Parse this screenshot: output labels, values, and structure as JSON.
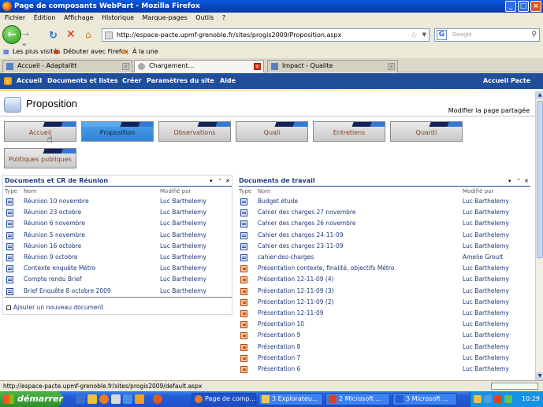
{
  "window": {
    "title": "Page de composants WebPart - Mozilla Firefox"
  },
  "menu": [
    "Fichier",
    "Édition",
    "Affichage",
    "Historique",
    "Marque-pages",
    "Outils",
    "?"
  ],
  "nav": {
    "url": "http://espace-pacte.upmf-grenoble.fr/sites/progis2009/Proposition.aspx",
    "search_placeholder": "Google"
  },
  "bookmarks": [
    "Les plus visités",
    "Débuter avec Firefox",
    "À la une"
  ],
  "tabs": [
    {
      "label": "Accueil - Adaptalitt",
      "active": false
    },
    {
      "label": "Chargement...",
      "active": true
    },
    {
      "label": "Impact - Qualite",
      "active": false
    }
  ],
  "sp_nav": {
    "items": [
      "Accueil",
      "Documents et listes",
      "Créer",
      "Paramètres du site",
      "Aide"
    ],
    "right": "Accueil Pacte"
  },
  "page": {
    "title": "Proposition",
    "modify_link": "Modifier la page partagée",
    "buttons": [
      {
        "label": "Accueil",
        "selected": false
      },
      {
        "label": "Proposition",
        "selected": true
      },
      {
        "label": "Observations",
        "selected": false
      },
      {
        "label": "Quali",
        "selected": false
      },
      {
        "label": "Entretiens",
        "selected": false
      },
      {
        "label": "Quanti",
        "selected": false
      },
      {
        "label": "Politiques publiques",
        "selected": false
      }
    ]
  },
  "left_part": {
    "title": "Documents et CR de Réunion",
    "headers": {
      "type": "Type",
      "name": "Nom",
      "modified_by": "Modifié par"
    },
    "rows": [
      {
        "icon": "word-doc-icon",
        "name": "Réunion 10 novembre",
        "by": "Luc Barthelemy"
      },
      {
        "icon": "word-doc-icon",
        "name": "Réunion 23 octobre",
        "by": "Luc Barthelemy"
      },
      {
        "icon": "word-doc-icon",
        "name": "Réunion 6 novembre",
        "by": "Luc Barthelemy"
      },
      {
        "icon": "word-doc-icon",
        "name": "Réunion 5 novembre",
        "by": "Luc Barthelemy"
      },
      {
        "icon": "word-doc-icon",
        "name": "Réunion 16 octobre",
        "by": "Luc Barthelemy"
      },
      {
        "icon": "word-doc-icon",
        "name": "Réunion 9 octobre",
        "by": "Luc Barthelemy"
      },
      {
        "icon": "word-doc-icon",
        "name": "Contexte enquête Métro",
        "by": "Luc Barthelemy"
      },
      {
        "icon": "word-doc-icon",
        "name": "Compte rendu Brief",
        "by": "Luc Barthelemy"
      },
      {
        "icon": "word-doc-icon",
        "name": "Brief Enquête 8 octobre 2009",
        "by": "Luc Barthelemy"
      }
    ],
    "add_link": "Ajouter un nouveau document"
  },
  "right_part": {
    "title": "Documents de travail",
    "headers": {
      "type": "Type",
      "name": "Nom",
      "modified_by": "Modifié par"
    },
    "rows": [
      {
        "icon": "word-doc-icon",
        "name": "Budget étude",
        "by": "Luc Barthelemy"
      },
      {
        "icon": "word-doc-icon",
        "name": "Cahier des charges 27 novembre",
        "by": "Luc Barthelemy"
      },
      {
        "icon": "word-doc-icon",
        "name": "Cahier des charges 26 novembre",
        "by": "Luc Barthelemy"
      },
      {
        "icon": "word-doc-icon",
        "name": "Cahier des charges 24-11-09",
        "by": "Luc Barthelemy"
      },
      {
        "icon": "word-doc-icon",
        "name": "Cahier des charges 23-11-09",
        "by": "Luc Barthelemy"
      },
      {
        "icon": "word-doc-icon",
        "name": "cahier-des-charges",
        "by": "Amelie Groult"
      },
      {
        "icon": "powerpoint-icon",
        "name": "Présentation contexte, finalité, objectifs Métro",
        "by": "Luc Barthelemy"
      },
      {
        "icon": "powerpoint-icon",
        "name": "Présentation 12-11-09 (4)",
        "by": "Luc Barthelemy"
      },
      {
        "icon": "powerpoint-icon",
        "name": "Présentation 12-11-09 (3)",
        "by": "Luc Barthelemy"
      },
      {
        "icon": "powerpoint-icon",
        "name": "Présentation 12-11-09 (2)",
        "by": "Luc Barthelemy"
      },
      {
        "icon": "powerpoint-icon",
        "name": "Présentation 12-11-09",
        "by": "Luc Barthelemy"
      },
      {
        "icon": "powerpoint-icon",
        "name": "Présentation 10",
        "by": "Luc Barthelemy"
      },
      {
        "icon": "powerpoint-icon",
        "name": "Présentation 9",
        "by": "Luc Barthelemy"
      },
      {
        "icon": "powerpoint-icon",
        "name": "Présentation 8",
        "by": "Luc Barthelemy"
      },
      {
        "icon": "powerpoint-icon",
        "name": "Présentation 7",
        "by": "Luc Barthelemy"
      },
      {
        "icon": "powerpoint-icon",
        "name": "Présentation 6",
        "by": "Luc Barthelemy"
      }
    ]
  },
  "status": {
    "text": "http://espace-pacte.upmf-grenoble.fr/sites/progis2009/default.aspx"
  },
  "taskbar": {
    "start": "démarrer",
    "tasks": [
      "Page de comp...",
      "3 Explorateu...",
      "2 Microsoft ...",
      "3 Microsoft ..."
    ],
    "clock": "10:29"
  },
  "colors": {
    "sp_bar": "#1f4f9a",
    "selected_button": "#2f84d8",
    "link": "#1f3a7a"
  }
}
